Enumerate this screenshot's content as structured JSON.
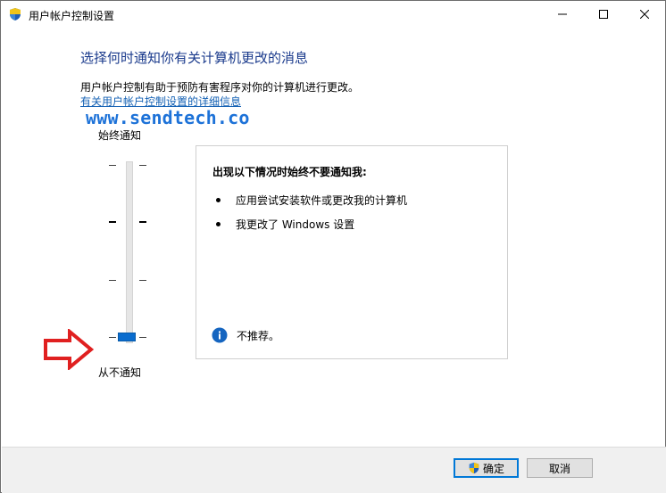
{
  "window": {
    "title": "用户帐户控制设置"
  },
  "header": {
    "heading": "选择何时通知你有关计算机更改的消息",
    "description": "用户帐户控制有助于预防有害程序对你的计算机进行更改。",
    "help_link": "有关用户帐户控制设置的详细信息",
    "watermark": "www.sendtech.co"
  },
  "slider": {
    "top_label": "始终通知",
    "bottom_label": "从不通知",
    "level_count": 4,
    "selected_level": 1,
    "thumb_color": "#0a6cce"
  },
  "panel": {
    "title": "出现以下情况时始终不要通知我:",
    "bullets": [
      "应用尝试安装软件或更改我的计算机",
      "我更改了 Windows 设置"
    ],
    "note": "不推荐。",
    "note_icon": "info-icon"
  },
  "footer": {
    "ok_label": "确定",
    "cancel_label": "取消"
  },
  "colors": {
    "heading": "#1a3a8c",
    "link": "#1461b4",
    "watermark": "#1d72d8",
    "arrow": "#e02020",
    "accent": "#0078d7"
  }
}
